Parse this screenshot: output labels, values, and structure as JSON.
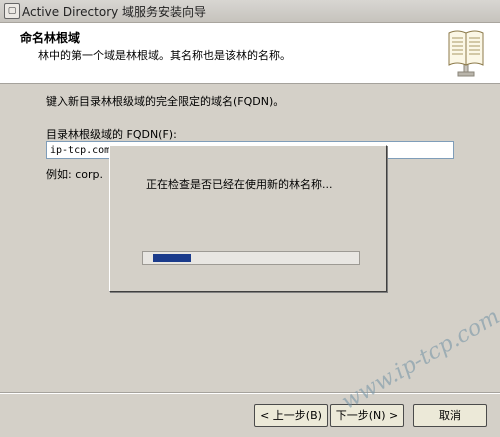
{
  "window": {
    "title": "Active Directory 域服务安装向导"
  },
  "header": {
    "title": "命名林根域",
    "subtitle": "林中的第一个域是林根域。其名称也是该林的名称。"
  },
  "main": {
    "instruction": "键入新目录林根级域的完全限定的域名(FQDN)。",
    "fqdn_label": "目录林根级域的 FQDN(F):",
    "fqdn_value": "ip-tcp.com",
    "example": "例如: corp."
  },
  "progress_dialog": {
    "message": "正在检查是否已经在使用新的林名称...",
    "progress_fraction": 0.18
  },
  "buttons": {
    "back": "< 上一步(B)",
    "next": "下一步(N) >",
    "cancel": "取消"
  },
  "watermark": "www.ip-tcp.com",
  "colors": {
    "progress_fill": "#1b3b8b",
    "background": "#d4d0c8"
  },
  "icons": {
    "title": "wizard-app-icon",
    "header": "open-book-icon"
  }
}
